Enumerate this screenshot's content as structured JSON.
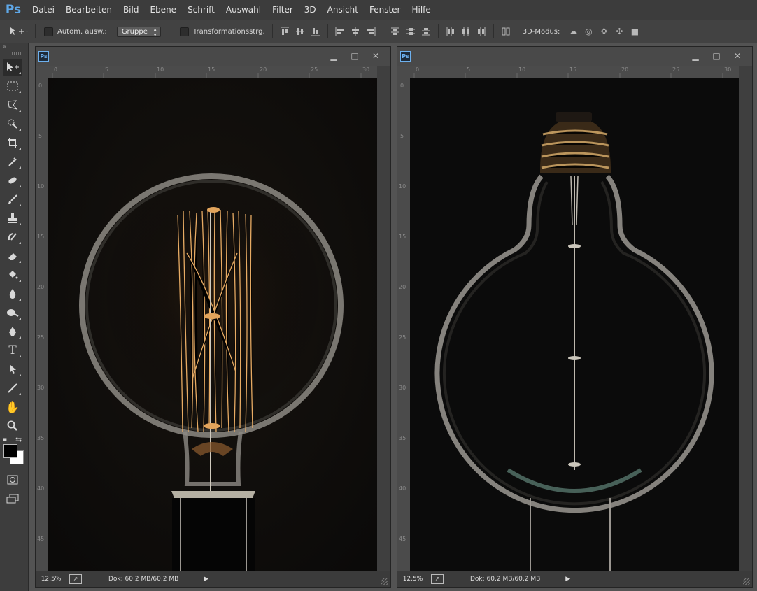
{
  "app": {
    "logo": "Ps"
  },
  "menu": [
    "Datei",
    "Bearbeiten",
    "Bild",
    "Ebene",
    "Schrift",
    "Auswahl",
    "Filter",
    "3D",
    "Ansicht",
    "Fenster",
    "Hilfe"
  ],
  "options": {
    "auto_select_label": "Autom. ausw.:",
    "auto_select_value": "Gruppe",
    "transform_label": "Transformationsstrg.",
    "mode3d_label": "3D-Modus:"
  },
  "toolpanel": {
    "collapse": "»"
  },
  "tools": [
    "move-tool",
    "marquee-tool",
    "lasso-tool",
    "quick-select-tool",
    "crop-tool",
    "eyedropper-tool",
    "healing-brush-tool",
    "brush-tool",
    "clone-stamp-tool",
    "history-brush-tool",
    "eraser-tool",
    "paint-bucket-tool",
    "blur-tool",
    "dodge-tool",
    "pen-tool",
    "type-tool",
    "path-select-tool",
    "line-tool",
    "hand-tool",
    "zoom-tool"
  ],
  "colors": {
    "foreground": "#000000",
    "background": "#ffffff",
    "accent": "#5fa8e8"
  },
  "documents": [
    {
      "badge": "Ps",
      "zoom": "12,5%",
      "doc_info": "Dok: 60,2 MB/60,2 MB",
      "ruler_h": [
        "0",
        "5",
        "10",
        "15",
        "20",
        "25",
        "30"
      ],
      "ruler_v": [
        "0",
        "5",
        "10",
        "15",
        "20",
        "25",
        "30",
        "35",
        "40",
        "45"
      ]
    },
    {
      "badge": "Ps",
      "zoom": "12,5%",
      "doc_info": "Dok: 60,2 MB/60,2 MB",
      "ruler_h": [
        "0",
        "5",
        "10",
        "15",
        "20",
        "25",
        "30"
      ],
      "ruler_v": [
        "0",
        "5",
        "10",
        "15",
        "20",
        "25",
        "30",
        "35",
        "40",
        "45"
      ]
    }
  ]
}
